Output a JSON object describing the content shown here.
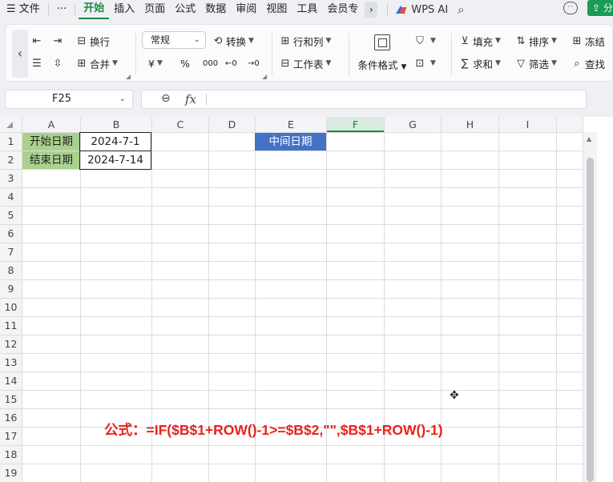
{
  "menu": {
    "hamburger": "☰",
    "file": "文件",
    "more": "···",
    "tabs": [
      "开始",
      "插入",
      "页面",
      "公式",
      "数据",
      "审阅",
      "视图",
      "工具",
      "会员专"
    ],
    "overflow": "›",
    "wps_ai": "WPS AI",
    "share": "分享"
  },
  "ribbon": {
    "wrap": "换行",
    "merge": "合并",
    "number_format": "常规",
    "convert": "转换",
    "currency": "¥",
    "percent": "%",
    "thousands": "000",
    "dec_inc": "←0",
    "dec_dec": "→0",
    "rows_cols": "行和列",
    "worksheet": "工作表",
    "cond_format": "条件格式",
    "fill": "填充",
    "sort": "排序",
    "freeze": "冻结",
    "sum": "求和",
    "filter": "筛选",
    "find": "查找"
  },
  "formula_bar": {
    "name_box": "F25",
    "formula": ""
  },
  "columns": [
    "A",
    "B",
    "C",
    "D",
    "E",
    "F",
    "G",
    "H",
    "I"
  ],
  "selected_column": "F",
  "rows": [
    "1",
    "2",
    "3",
    "4",
    "5",
    "6",
    "7",
    "8",
    "9",
    "10",
    "11",
    "12",
    "13",
    "14",
    "15",
    "16",
    "17",
    "18",
    "19"
  ],
  "cells": {
    "A1": "开始日期",
    "B1": "2024-7-1",
    "A2": "结束日期",
    "B2": "2024-7-14",
    "E1": "中间日期"
  },
  "annotation": "公式：=IF($B$1+ROW()-1>=$B$2,\"\",$B$1+ROW()-1)",
  "colors": {
    "accent_green": "#1a8a45",
    "label_green": "#a9d18e",
    "header_blue": "#4472c4",
    "annotation_red": "#e8231a"
  }
}
